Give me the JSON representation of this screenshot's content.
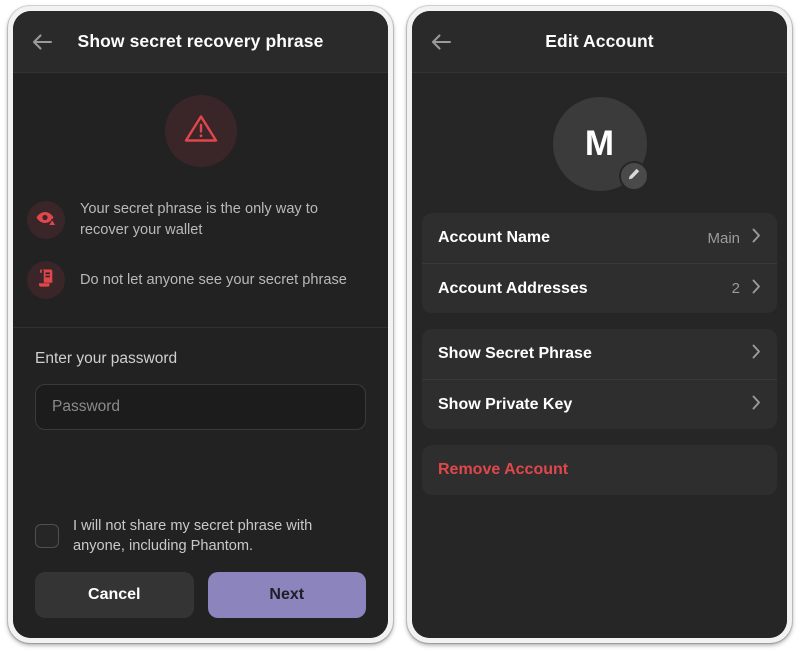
{
  "colors": {
    "frame": "#f2f2f2",
    "screen_bg": "#222222",
    "header_bg": "#2a2a2a",
    "card_bg": "#2e2e2e",
    "accent_purple": "#8b84bd",
    "danger_red": "#e0474c",
    "warn_circle_bg": "#3a2628"
  },
  "left_panel": {
    "header": {
      "back_icon": "arrow-left-icon",
      "title": "Show secret recovery phrase"
    },
    "warning_icon": "warning-triangle-icon",
    "bullets": [
      {
        "icon": "eye-warning-icon",
        "text": "Your secret phrase is the only way to recover your wallet"
      },
      {
        "icon": "scroll-document-icon",
        "text": "Do not let anyone see your secret phrase"
      }
    ],
    "password": {
      "label": "Enter your password",
      "placeholder": "Password",
      "value": ""
    },
    "consent": {
      "checked": false,
      "text": "I will not share my secret phrase with anyone, including Phantom."
    },
    "buttons": {
      "cancel": "Cancel",
      "next": "Next"
    }
  },
  "right_panel": {
    "header": {
      "back_icon": "arrow-left-icon",
      "title": "Edit Account"
    },
    "avatar": {
      "letter": "M",
      "edit_icon": "pencil-icon"
    },
    "groups": [
      {
        "rows": [
          {
            "label": "Account Name",
            "value": "Main",
            "chevron": "chevron-right-icon",
            "danger": false
          },
          {
            "label": "Account Addresses",
            "value": "2",
            "chevron": "chevron-right-icon",
            "danger": false
          }
        ]
      },
      {
        "rows": [
          {
            "label": "Show Secret Phrase",
            "value": "",
            "chevron": "chevron-right-icon",
            "danger": false
          },
          {
            "label": "Show Private Key",
            "value": "",
            "chevron": "chevron-right-icon",
            "danger": false
          }
        ]
      },
      {
        "rows": [
          {
            "label": "Remove Account",
            "value": "",
            "chevron": "",
            "danger": true
          }
        ]
      }
    ]
  }
}
